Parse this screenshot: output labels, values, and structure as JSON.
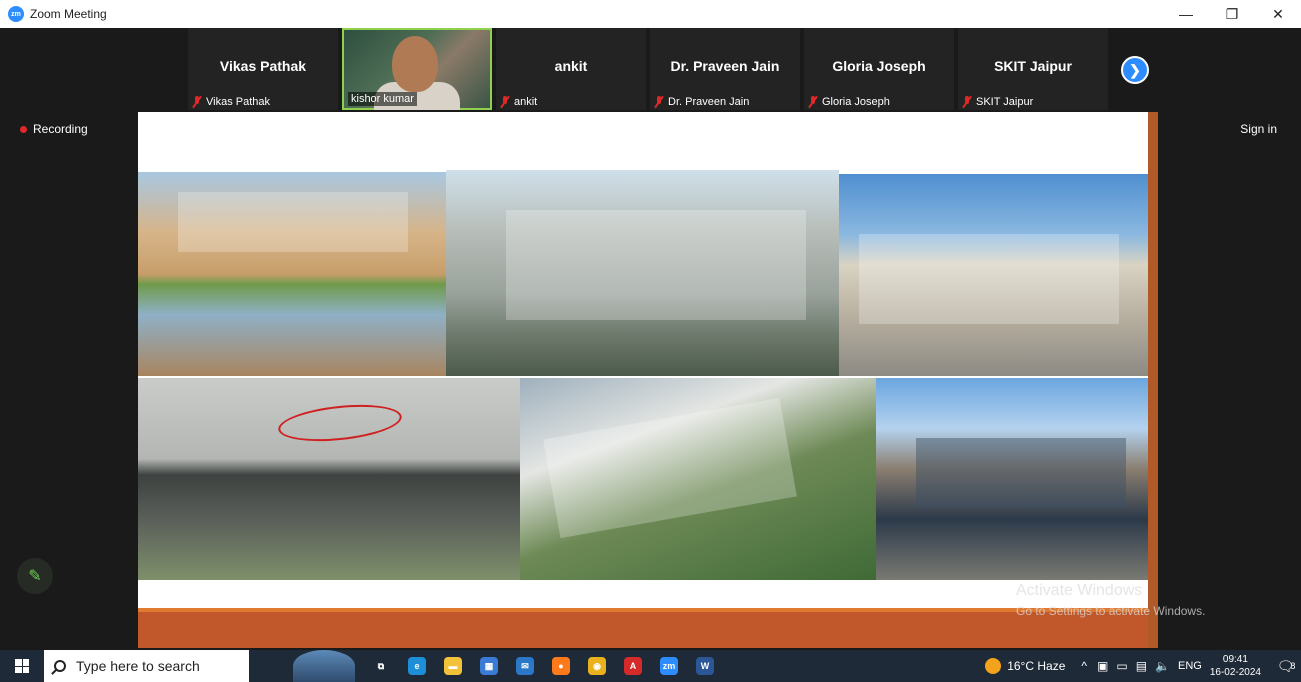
{
  "window": {
    "title": "Zoom Meeting",
    "logo": "zm"
  },
  "controls": {
    "minimize": "—",
    "restore": "❐",
    "close": "✕"
  },
  "participants": [
    {
      "name": "Vikas Pathak",
      "label": "Vikas Pathak",
      "muted": true,
      "video": false
    },
    {
      "name": "",
      "label": "kishor kumar",
      "muted": false,
      "video": true
    },
    {
      "name": "ankit",
      "label": "ankit",
      "muted": true,
      "video": false
    },
    {
      "name": "Dr. Praveen Jain",
      "label": "Dr. Praveen Jain",
      "muted": true,
      "video": false
    },
    {
      "name": "Gloria Joseph",
      "label": "Gloria Joseph",
      "muted": true,
      "video": false
    },
    {
      "name": "SKIT Jaipur",
      "label": "SKIT Jaipur",
      "muted": true,
      "video": false
    }
  ],
  "recording": {
    "label": "Recording"
  },
  "signin": {
    "label": "Sign in"
  },
  "watermark": {
    "title": "Activate Windows",
    "subtitle": "Go to Settings to activate Windows."
  },
  "taskbar": {
    "search_placeholder": "Type here to search",
    "apps": [
      {
        "name": "task-view-icon",
        "glyph": "⧉",
        "color": "#1f2a38"
      },
      {
        "name": "edge-icon",
        "glyph": "e",
        "color": "#1d8fd8"
      },
      {
        "name": "file-explorer-icon",
        "glyph": "▬",
        "color": "#f2c23a"
      },
      {
        "name": "store-icon",
        "glyph": "▦",
        "color": "#3a7bd5"
      },
      {
        "name": "mail-icon",
        "glyph": "✉",
        "color": "#2b78c9"
      },
      {
        "name": "firefox-icon",
        "glyph": "●",
        "color": "#ff7a1a"
      },
      {
        "name": "chrome-icon",
        "glyph": "◉",
        "color": "#e9b21c"
      },
      {
        "name": "acrobat-icon",
        "glyph": "A",
        "color": "#d52a2a"
      },
      {
        "name": "zoom-icon",
        "glyph": "zm",
        "color": "#2d8cff"
      },
      {
        "name": "word-icon",
        "glyph": "W",
        "color": "#2b5797"
      }
    ],
    "weather": "16°C  Haze",
    "tray_chevron": "^",
    "language": "ENG",
    "time": "09:41",
    "date": "16-02-2024",
    "notifications": "8"
  },
  "colors": {
    "accent": "#2d8cff",
    "recording": "#e02828",
    "active_speaker": "#8fd14f"
  }
}
